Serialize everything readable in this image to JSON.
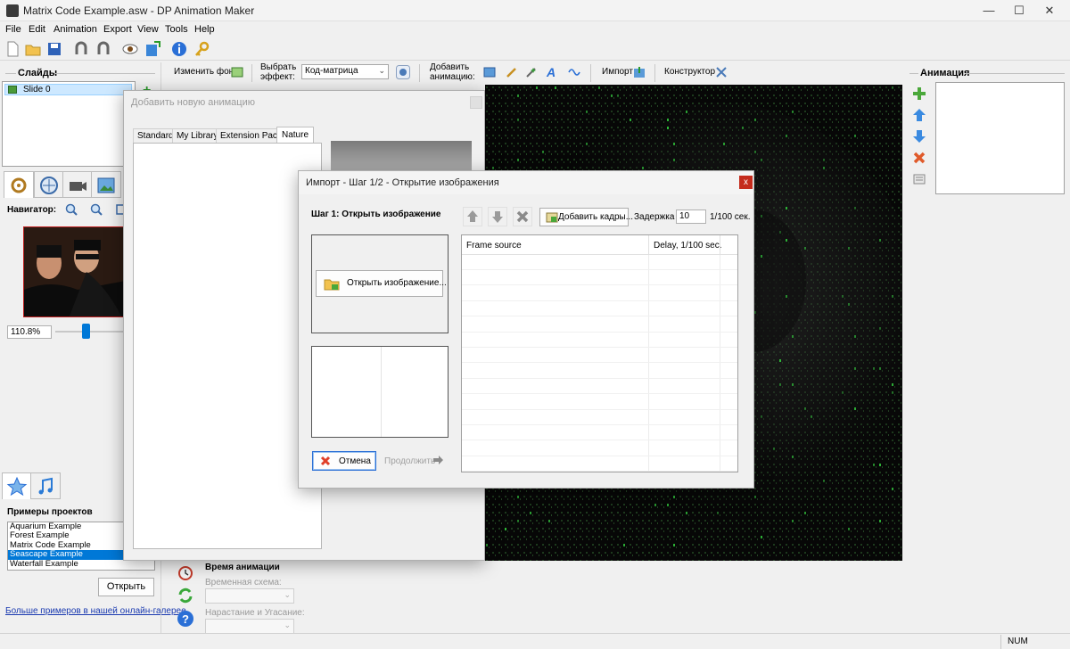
{
  "window": {
    "title": "Matrix Code Example.asw - DP Animation Maker",
    "minimize": "—",
    "maximize": "☐",
    "close": "✕"
  },
  "menu": [
    "File",
    "Edit",
    "Animation",
    "Export",
    "View",
    "Tools",
    "Help"
  ],
  "toolbar2": {
    "change_bg": "Изменить фон",
    "choose_effect_1": "Выбрать",
    "choose_effect_2": "эффект:",
    "effect_value": "Код-матрица",
    "add_anim_1": "Добавить",
    "add_anim_2": "анимацию:",
    "import": "Импорт",
    "constructor": "Конструктор"
  },
  "left": {
    "slides_title": "Слайды",
    "slide_item": "Slide 0",
    "navigator_title": "Навигатор:",
    "zoom_value": "110.8%",
    "examples_title": "Примеры проектов",
    "examples": [
      "Aquarium Example",
      "Forest Example",
      "Matrix Code Example",
      "Seascape Example",
      "Waterfall Example"
    ],
    "selected_example_index": 3,
    "open_button": "Открыть",
    "gallery_link": "Больше примеров в нашей онлайн-галерее"
  },
  "bottom": {
    "timing_title": "Время анимации",
    "time_scheme_label": "Временная схема:",
    "fade_label": "Нарастание и Угасание:"
  },
  "right": {
    "animation_title": "Анимация"
  },
  "add_dialog": {
    "title": "Добавить новую анимацию",
    "tabs": [
      "Standard",
      "My Library",
      "Extension Pack",
      "Nature"
    ],
    "active_tab_index": 3
  },
  "import_dialog": {
    "title": "Импорт - Шаг 1/2 - Открытие изображения",
    "step_label": "Шаг 1: Открыть изображение",
    "open_image_button": "Открыть изображение...",
    "add_frames_button": "Добавить кадры...",
    "delay_label": "Задержка",
    "delay_value": "10",
    "delay_unit": "1/100 сек.",
    "col_frame_source": "Frame source",
    "col_delay": "Delay, 1/100 sec.",
    "cancel_button": "Отмена",
    "continue_button": "Продолжить"
  },
  "status": {
    "num": "NUM"
  },
  "colors": {
    "selection": "#0078d7",
    "accent_blue": "#2a6fd6",
    "canvas_bg": "#070707",
    "matrix_green": "#2fbf3a",
    "dialog_close_red": "#c42b1c"
  }
}
